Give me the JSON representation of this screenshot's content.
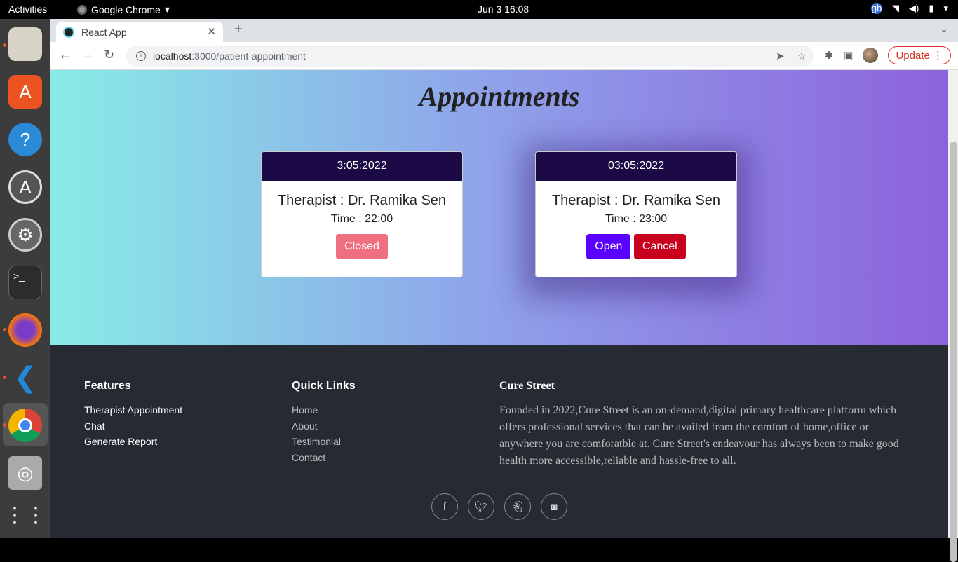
{
  "system": {
    "activities": "Activities",
    "app_name": "Google Chrome",
    "clock": "Jun 3  16:08"
  },
  "browser": {
    "tab_title": "React App",
    "url_host": "localhost",
    "url_path": ":3000/patient-appointment",
    "update_label": "Update"
  },
  "page": {
    "title": "Appointments",
    "appointments": [
      {
        "date": "3:05:2022",
        "therapist": "Therapist : Dr. Ramika Sen",
        "time": "Time : 22:00",
        "closed_label": "Closed"
      },
      {
        "date": "03:05:2022",
        "therapist": "Therapist : Dr. Ramika Sen",
        "time": "Time : 23:00",
        "open_label": "Open",
        "cancel_label": "Cancel"
      }
    ]
  },
  "footer": {
    "features": {
      "heading": "Features",
      "items": [
        "Therapist Appointment",
        "Chat",
        "Generate Report"
      ]
    },
    "quick_links": {
      "heading": "Quick Links",
      "items": [
        "Home",
        "About",
        "Testimonial",
        "Contact"
      ]
    },
    "about": {
      "heading": "Cure Street",
      "text": "Founded in 2022,Cure Street is an on-demand,digital primary healthcare platform which offers professional services that can be availed from the comfort of home,office or anywhere you are comforatble at. Cure Street's endeavour has always been to make good health more accessible,reliable and hassle-free to all."
    },
    "social": [
      "facebook-icon",
      "twitter-icon",
      "snapchat-icon",
      "instagram-icon"
    ]
  },
  "colors": {
    "card_header": "#1c0a46",
    "closed_button": "#ee7080",
    "open_button": "#5a00ff",
    "cancel_button": "#c8001e",
    "footer_bg": "#262a33"
  }
}
